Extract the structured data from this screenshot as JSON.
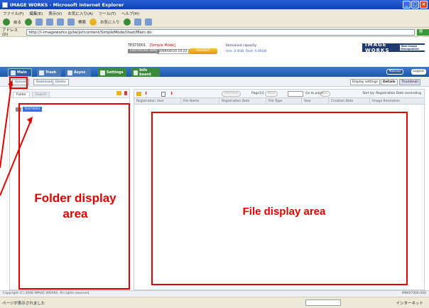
{
  "window": {
    "title": "IMAGE WORKS - Microsoft Internet Explorer"
  },
  "menu": [
    "ファイル(F)",
    "編集(E)",
    "表示(V)",
    "お気に入り(A)",
    "ツール(T)",
    "ヘルプ(H)"
  ],
  "toolbar": {
    "back": "戻る",
    "search": "検索",
    "favorites": "お気に入り"
  },
  "address": {
    "label": "アドレス(D)",
    "url": "http://i-imageworks.jp/iw/jsf/content/SimpleMode/User/Main.do",
    "go": "移動"
  },
  "header": {
    "user_id": "TEST0001",
    "mode": "[Simple Mode]",
    "last_access_label": "Last Access Date",
    "last_access_value": "2009/04/20 10:22",
    "logout": "LOGOUT",
    "capacity_title": "Remained capacity",
    "capacity_value": "Use: 0.0GB, Rest: 0.00GB",
    "logo": "IMAGE WORKS",
    "logo_tag": "Total Image Management"
  },
  "tabs": [
    {
      "label": "Main"
    },
    {
      "label": "Trash"
    },
    {
      "label": "Async"
    },
    {
      "label": "Settings"
    },
    {
      "label": "Info board"
    }
  ],
  "top_right": {
    "help": "Manual",
    "mypage": "Logout"
  },
  "actions": {
    "upload": "Upload",
    "download": "Download",
    "delete": "Delete"
  },
  "view": {
    "display_settings": "Display settings",
    "details": "Details",
    "thumbnail": "Thumbnail"
  },
  "left_pane": {
    "tab_folder": "Folder",
    "tab_search": "Search",
    "root_folder": "TEST0001"
  },
  "right_pane": {
    "prev": "Previous",
    "page_info": "Page1/1",
    "next": "Next",
    "goto_label": "Go to page",
    "goto_button": "Go",
    "sort": "Sort by: Registration Date ascending",
    "columns": [
      "Registration User",
      "File Name",
      "Registration Date",
      "File Type",
      "Size",
      "Creation Date",
      "Image Resolution"
    ]
  },
  "annotations": {
    "folder_area": "Folder display area",
    "file_area": "File display area"
  },
  "footer": {
    "copyright": "Copyright (C) 2006 IMAGE WORKS. All rights reserved.",
    "right": "IMW07000-000"
  },
  "ie_status": {
    "left": "ページが表示されました",
    "zone": "インターネット"
  }
}
